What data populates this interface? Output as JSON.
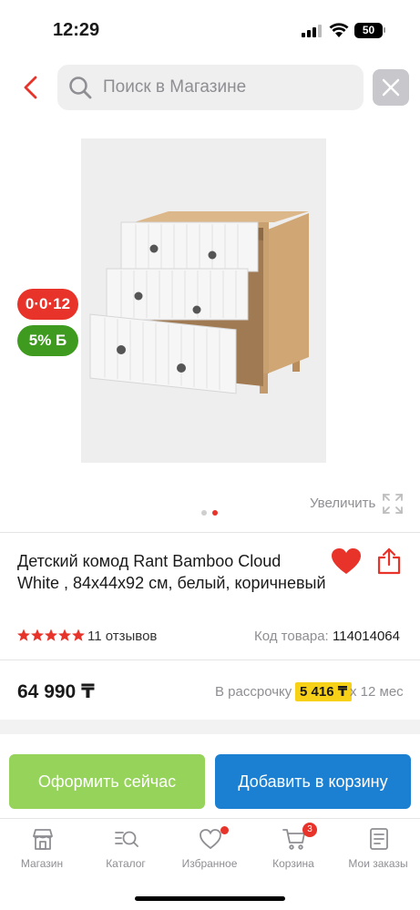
{
  "status_bar": {
    "time": "12:29",
    "battery": "50"
  },
  "search": {
    "placeholder": "Поиск в Магазине"
  },
  "badges": {
    "timer": "0·0·12",
    "bonus": "5% Б"
  },
  "gallery": {
    "zoom_label": "Увеличить",
    "total_slides": 2,
    "active_slide": 2
  },
  "product": {
    "title": "Детский комод Rant  Bamboo Cloud White , 84x44x92 см, белый, коричневый",
    "rating": 5,
    "reviews": "11 отзывов",
    "code_label": "Код товара:",
    "code_value": "114014064",
    "price": "64 990 ₸",
    "installment_label": "В рассрочку",
    "installment_amount": "5 416 ₸",
    "installment_term": "х 12 мес"
  },
  "actions": {
    "buy_now": "Оформить сейчас",
    "add_to_cart": "Добавить в корзину"
  },
  "tabbar": {
    "items": [
      {
        "label": "Магазин",
        "icon": "store-icon"
      },
      {
        "label": "Каталог",
        "icon": "catalog-search-icon"
      },
      {
        "label": "Избранное",
        "icon": "heart-icon"
      },
      {
        "label": "Корзина",
        "icon": "cart-icon",
        "count": "3"
      },
      {
        "label": "Мои заказы",
        "icon": "orders-icon"
      }
    ]
  },
  "colors": {
    "accent_red": "#e8332a",
    "buy_green": "#95d35a",
    "cart_blue": "#1c80d2",
    "installment_yellow": "#f7d117"
  }
}
